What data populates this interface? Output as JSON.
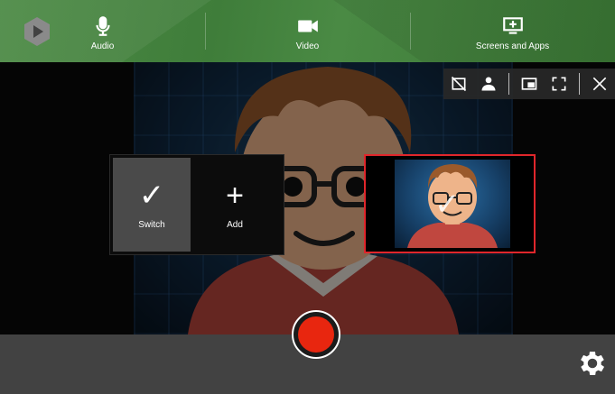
{
  "sources": [
    {
      "label": "Audio",
      "icon": "microphone-icon"
    },
    {
      "label": "Video",
      "icon": "video-camera-icon"
    },
    {
      "label": "Screens and Apps",
      "icon": "screen-add-icon"
    }
  ],
  "overlay_controls": [
    {
      "icon": "camera-off-icon"
    },
    {
      "icon": "person-icon"
    },
    {
      "icon": "picture-in-picture-icon"
    },
    {
      "icon": "fullscreen-icon"
    },
    {
      "icon": "close-icon"
    }
  ],
  "popup": {
    "switch_label": "Switch",
    "add_label": "Add",
    "switch_glyph": "✓",
    "add_glyph": "+"
  },
  "thumbnail": {
    "check_glyph": "✓",
    "border_color": "#e0262b"
  },
  "bottom": {
    "logo_icon": "app-logo-icon",
    "record_icon": "record-icon",
    "settings_icon": "gear-icon"
  },
  "colors": {
    "topbar_green": "#3f7d3a",
    "record_red": "#e8260f",
    "bottombar": "#424242"
  }
}
